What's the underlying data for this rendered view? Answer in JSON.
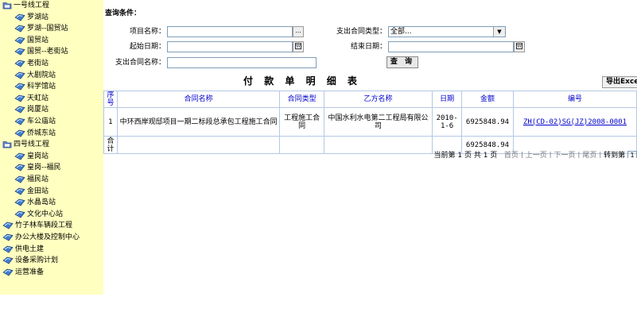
{
  "sidebar": {
    "items": [
      {
        "label": "一号线工程",
        "type": "folder",
        "level": 0
      },
      {
        "label": "罗湖站",
        "type": "item",
        "level": 1
      },
      {
        "label": "罗湖--国贸站",
        "type": "item",
        "level": 1
      },
      {
        "label": "国贸站",
        "type": "item",
        "level": 1
      },
      {
        "label": "国贸--老街站",
        "type": "item",
        "level": 1
      },
      {
        "label": "老街站",
        "type": "item",
        "level": 1
      },
      {
        "label": "大剧院站",
        "type": "item",
        "level": 1
      },
      {
        "label": "科学馆站",
        "type": "item",
        "level": 1
      },
      {
        "label": "天虹站",
        "type": "item",
        "level": 1
      },
      {
        "label": "岗厦站",
        "type": "item",
        "level": 1
      },
      {
        "label": "车公庙站",
        "type": "item",
        "level": 1
      },
      {
        "label": "侨城东站",
        "type": "item",
        "level": 1
      },
      {
        "label": "四号线工程",
        "type": "folder",
        "level": 0
      },
      {
        "label": "皇岗站",
        "type": "item",
        "level": 1
      },
      {
        "label": "皇岗--福民",
        "type": "item",
        "level": 1
      },
      {
        "label": "福民站",
        "type": "item",
        "level": 1
      },
      {
        "label": "金田站",
        "type": "item",
        "level": 1
      },
      {
        "label": "水晶岛站",
        "type": "item",
        "level": 1
      },
      {
        "label": "文化中心站",
        "type": "item",
        "level": 1
      },
      {
        "label": "竹子林车辆段工程",
        "type": "item",
        "level": 0
      },
      {
        "label": "办公大楼及控制中心",
        "type": "item",
        "level": 0
      },
      {
        "label": "供电土建",
        "type": "item",
        "level": 0
      },
      {
        "label": "设备采购计划",
        "type": "item",
        "level": 0
      },
      {
        "label": "运营准备",
        "type": "item",
        "level": 0
      }
    ]
  },
  "query": {
    "section_title": "查询条件：",
    "project_name_label": "项目名称：",
    "project_name_value": "",
    "browse_button": "...",
    "contract_type_label": "支出合同类型：",
    "contract_type_value": "全部...",
    "start_date_label": "起始日期：",
    "start_date_value": "",
    "end_date_label": "结束日期：",
    "end_date_value": "",
    "contract_name_label": "支出合同名称：",
    "contract_name_value": "",
    "search_button": "查 询"
  },
  "report": {
    "title": "付 款 单 明 细 表",
    "export_button": "导出Excel",
    "columns": [
      "序号",
      "合同名称",
      "合同类型",
      "乙方名称",
      "日期",
      "金额",
      "编号"
    ],
    "rows": [
      {
        "index": "1",
        "contract_name": "中环西岸观邸项目一期二标段总承包工程施工合同",
        "contract_type": "工程施工合同",
        "party_b": "中国水利水电第二工程局有限公司",
        "date": "2010-1-6",
        "amount": "6925848.94",
        "code": "ZH(CD-02)SG(JZ)2008-0001"
      }
    ],
    "total_label": "合计",
    "total_amount": "6925848.94"
  },
  "pager": {
    "text": "当前第 1 页 共 1 页",
    "first": "首页",
    "prev": "上一页",
    "next": "下一页",
    "last": "尾页",
    "jump_label": "转到第",
    "jump_value": "1"
  }
}
